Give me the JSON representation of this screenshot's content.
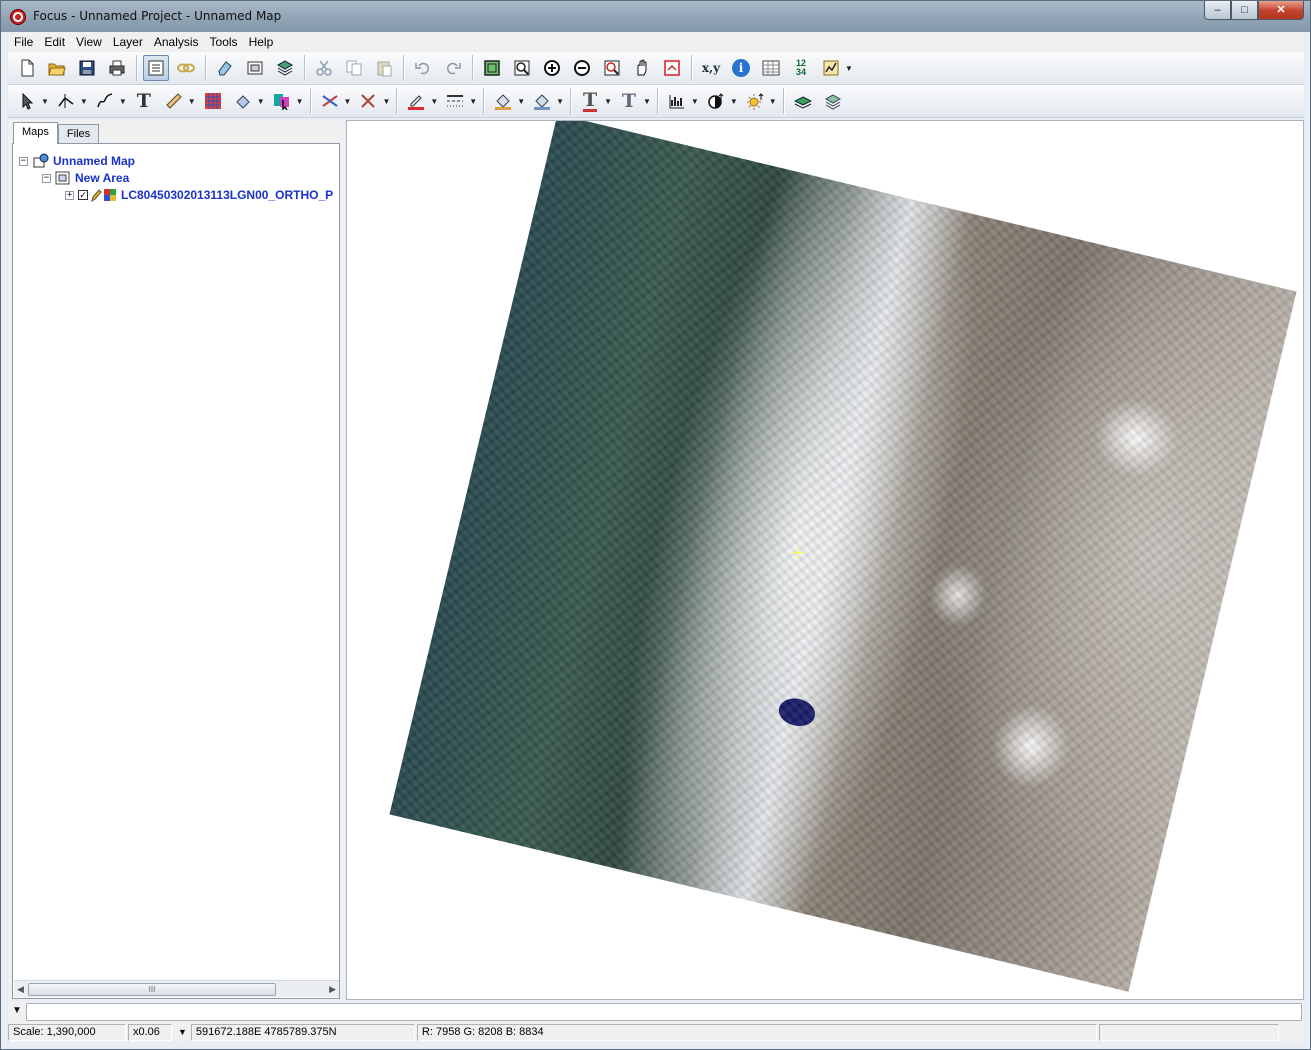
{
  "window": {
    "title": "Focus - Unnamed Project - Unnamed Map",
    "controls": {
      "minimize": "–",
      "maximize": "□",
      "close": "✕"
    }
  },
  "menu": [
    "File",
    "Edit",
    "View",
    "Layer",
    "Analysis",
    "Tools",
    "Help"
  ],
  "toolbar1": {
    "coord_label": "x,y",
    "info_label": "i",
    "numbers_label": "12 34"
  },
  "toolbar2": {
    "text_tool_a": "T",
    "text_tool_b": "T",
    "text_tool_c": "T"
  },
  "left_panel": {
    "tabs": [
      "Maps",
      "Files"
    ],
    "tree": {
      "map": "Unnamed Map",
      "area": "New Area",
      "layer": "LC80450302013113LGN00_ORTHO_P"
    },
    "scrollbar_grip": "III"
  },
  "status": {
    "scale": "Scale: 1,390,000",
    "zoom": "x0.06",
    "coords": "591672.188E 4785789.375N",
    "pixel": "R: 7958 G: 8208 B: 8834"
  },
  "colors": {
    "tree_link": "#1a32c8",
    "crosshair": "#ffff40"
  }
}
